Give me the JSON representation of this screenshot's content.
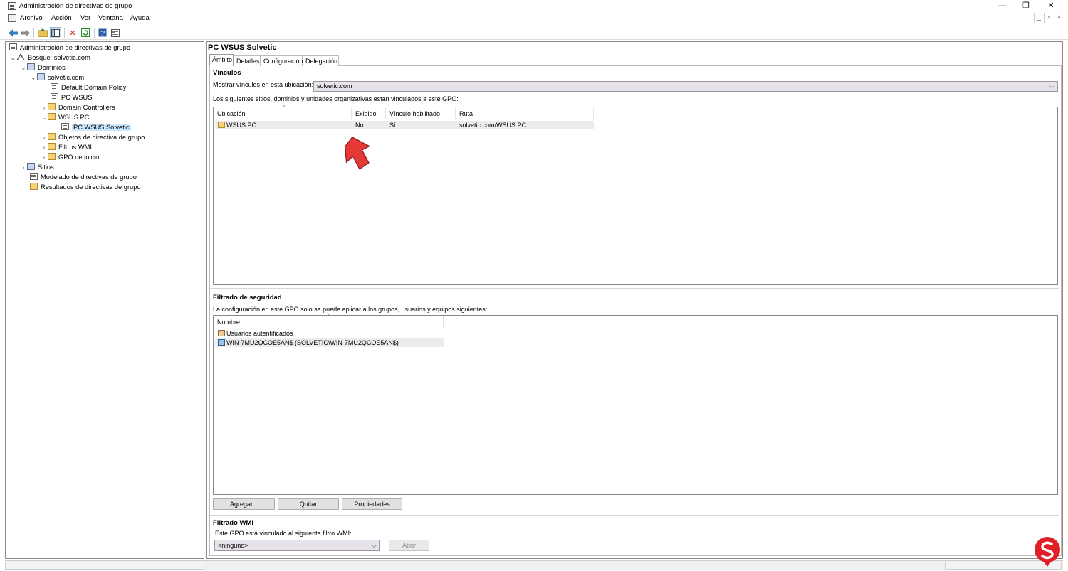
{
  "window": {
    "title": "Administración de directivas de grupo",
    "controls": {
      "minimize": "—",
      "restore": "❐",
      "close": "✕"
    },
    "mdi_controls": {
      "minimize": "_",
      "restore": "▫",
      "close": "×"
    }
  },
  "menu": [
    "Archivo",
    "Acción",
    "Ver",
    "Ventana",
    "Ayuda"
  ],
  "toolbar": [
    "back-icon",
    "forward-icon",
    "up-folder-icon",
    "show-hide-tree-icon",
    "delete-icon",
    "refresh-icon",
    "help-icon",
    "properties-icon"
  ],
  "tree": {
    "root": "Administración de directivas de grupo",
    "forest": "Bosque: solvetic.com",
    "domains": "Dominios",
    "domain": "solvetic.com",
    "default_policy": "Default Domain Policy",
    "pc_wsus": "PC WSUS",
    "domain_controllers": "Domain Controllers",
    "wsus_pc": "WSUS PC",
    "pc_wsus_solvetic": "PC WSUS Solvetic",
    "gpo_objects": "Objetos de directiva de grupo",
    "wmi_filters": "Filtros WMI",
    "starter_gpos": "GPO de inicio",
    "sites": "Sitios",
    "modeling": "Modelado de directivas de grupo",
    "results": "Resultados de directivas de grupo"
  },
  "gpo": {
    "title": "PC WSUS Solvetic",
    "tabs": [
      "Ámbito",
      "Detalles",
      "Configuración",
      "Delegación"
    ],
    "links": {
      "section_title": "Vínculos",
      "show_label": "Mostrar vínculos en esta ubicación:",
      "location_value": "solvetic.com",
      "description": "Los siguientes sitios, dominios y unidades organizativas están vinculados a este GPO:",
      "columns": [
        "Ubicación",
        "Exigido",
        "Vínculo habilitado",
        "Ruta"
      ],
      "rows": [
        {
          "location": "WSUS PC",
          "enforced": "No",
          "enabled": "Sí",
          "path": "solvetic.com/WSUS PC"
        }
      ]
    },
    "security": {
      "section_title": "Filtrado de seguridad",
      "description": "La configuración en este GPO solo se puede aplicar a los grupos, usuarios y equipos siguientes:",
      "column": "Nombre",
      "rows": [
        "Usuarios autentificados",
        "WIN-7MU2QCOE5AN$ (SOLVETIC\\WIN-7MU2QCOE5AN$)"
      ],
      "buttons": {
        "add": "Agregar...",
        "remove": "Quitar",
        "properties": "Propiedades"
      }
    },
    "wmi": {
      "section_title": "Filtrado WMI",
      "description": "Este GPO está vinculado al siguiente filtro WMI:",
      "filter_value": "<ninguno>",
      "open_button": "Abrir"
    }
  },
  "colors": {
    "selection": "#cce8ff",
    "arrow": "#e53935",
    "combo_bg": "#e8e2ea"
  }
}
